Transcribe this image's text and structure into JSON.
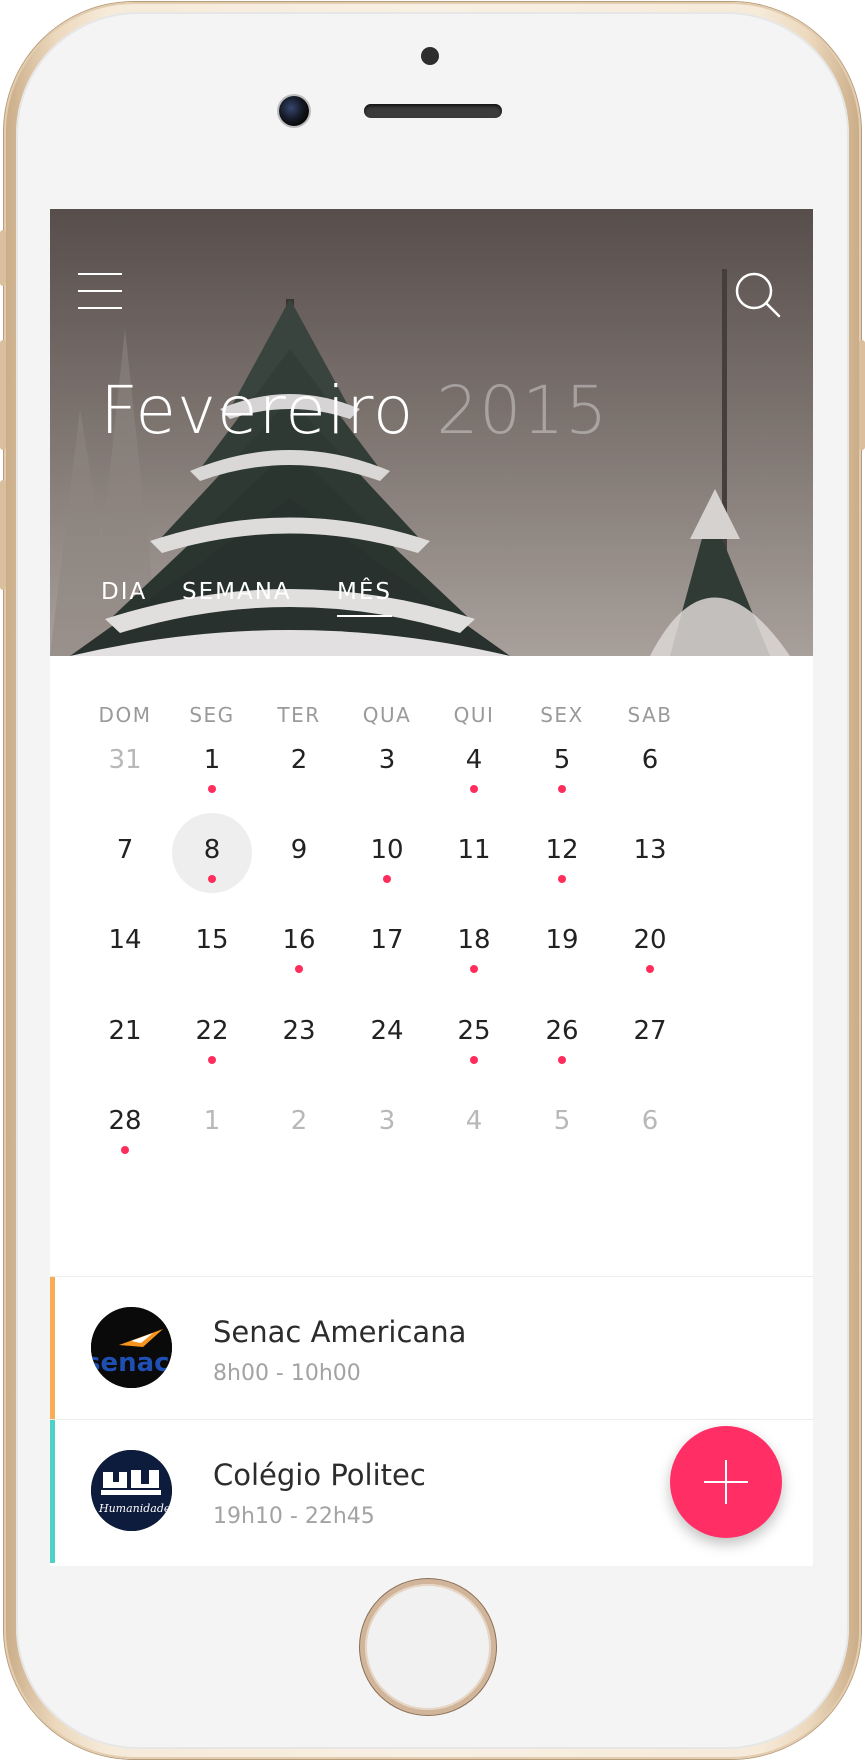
{
  "header": {
    "month": "Fevereiro",
    "year": "2015",
    "tabs": [
      {
        "label": "DIA",
        "active": false
      },
      {
        "label": "SEMANA",
        "active": false
      },
      {
        "label": "MÊS",
        "active": true
      }
    ]
  },
  "calendar": {
    "weekdays": [
      "DOM",
      "SEG",
      "TER",
      "QUA",
      "QUI",
      "SEX",
      "SAB"
    ],
    "weeks": [
      [
        {
          "d": "31",
          "muted": true
        },
        {
          "d": "1",
          "dot": true
        },
        {
          "d": "2"
        },
        {
          "d": "3"
        },
        {
          "d": "4",
          "dot": true
        },
        {
          "d": "5",
          "dot": true
        },
        {
          "d": "6"
        }
      ],
      [
        {
          "d": "7"
        },
        {
          "d": "8",
          "dot": true,
          "selected": true
        },
        {
          "d": "9"
        },
        {
          "d": "10",
          "dot": true
        },
        {
          "d": "11"
        },
        {
          "d": "12",
          "dot": true
        },
        {
          "d": "13"
        }
      ],
      [
        {
          "d": "14"
        },
        {
          "d": "15"
        },
        {
          "d": "16",
          "dot": true
        },
        {
          "d": "17"
        },
        {
          "d": "18",
          "dot": true
        },
        {
          "d": "19"
        },
        {
          "d": "20",
          "dot": true
        }
      ],
      [
        {
          "d": "21"
        },
        {
          "d": "22",
          "dot": true
        },
        {
          "d": "23"
        },
        {
          "d": "24"
        },
        {
          "d": "25",
          "dot": true
        },
        {
          "d": "26",
          "dot": true
        },
        {
          "d": "27"
        }
      ],
      [
        {
          "d": "28",
          "dot": true
        },
        {
          "d": "1",
          "muted": true
        },
        {
          "d": "2",
          "muted": true
        },
        {
          "d": "3",
          "muted": true
        },
        {
          "d": "4",
          "muted": true
        },
        {
          "d": "5",
          "muted": true
        },
        {
          "d": "6",
          "muted": true
        }
      ]
    ],
    "dot_color": "#ff2d5c"
  },
  "events": [
    {
      "name": "Senac Americana",
      "time": "8h00 - 10h00",
      "accent": "#f6ad55",
      "logo": "senac-logo"
    },
    {
      "name": "Colégio Politec",
      "time": "19h10 - 22h45",
      "accent": "#4fd1c5",
      "logo": "politec-logo",
      "logo_text": "Humanidade"
    }
  ],
  "fab": {
    "icon": "plus-icon",
    "color": "#ff2f66"
  }
}
